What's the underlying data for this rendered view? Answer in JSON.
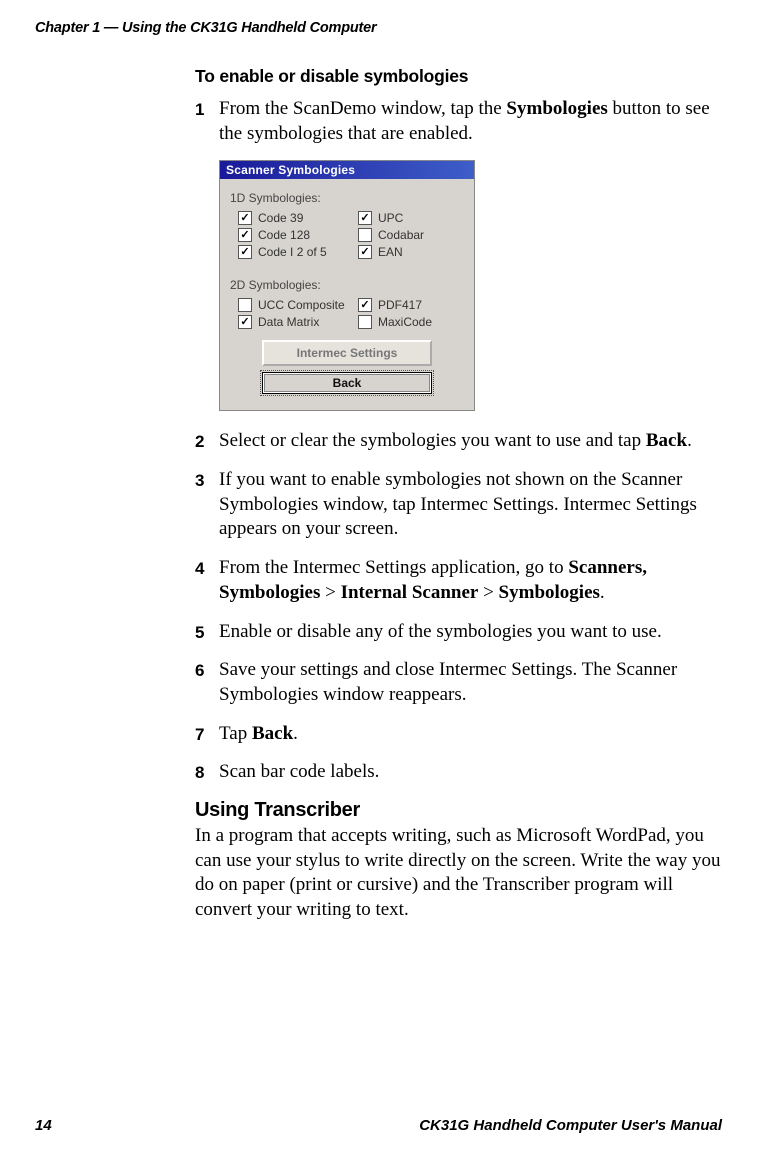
{
  "header": {
    "chapter_line": "Chapter 1 — Using the CK31G Handheld Computer"
  },
  "section_a": {
    "heading": "To enable or disable symbologies",
    "steps": {
      "s1": {
        "num": "1",
        "pre": "From the ScanDemo window, tap the ",
        "bold": "Symbologies",
        "post": " button to see the symbologies that are enabled."
      },
      "s2": {
        "num": "2",
        "pre": "Select or clear the symbologies you want to use and tap ",
        "bold": "Back",
        "post": "."
      },
      "s3": {
        "num": "3",
        "text": "If you want to enable symbologies not shown on the Scanner Symbologies window, tap Intermec Settings. Intermec Settings appears on your screen."
      },
      "s4": {
        "num": "4",
        "pre": "From the Intermec Settings application, go to ",
        "b1": "Scanners, Symbologies",
        "mid1": " > ",
        "b2": "Internal Scanner",
        "mid2": " > ",
        "b3": "Symbologies",
        "post": "."
      },
      "s5": {
        "num": "5",
        "text": "Enable or disable any of the symbologies you want to use."
      },
      "s6": {
        "num": "6",
        "text": "Save your settings and close Intermec Settings. The Scanner Symbologies window reappears."
      },
      "s7": {
        "num": "7",
        "pre": "Tap ",
        "bold": "Back",
        "post": "."
      },
      "s8": {
        "num": "8",
        "text": "Scan bar code labels."
      }
    }
  },
  "screenshot": {
    "title": "Scanner Symbologies",
    "group1_label": "1D Symbologies:",
    "group2_label": "2D Symbologies:",
    "cb": {
      "code39": "Code 39",
      "code128": "Code 128",
      "codei2of5": "Code I 2 of 5",
      "upc": "UPC",
      "codabar": "Codabar",
      "ean": "EAN",
      "ucc": "UCC Composite",
      "datamatrix": "Data Matrix",
      "pdf417": "PDF417",
      "maxicode": "MaxiCode"
    },
    "btn_intermec": "Intermec Settings",
    "btn_back": "Back"
  },
  "section_b": {
    "heading": "Using Transcriber",
    "para": "In a program that accepts writing, such as Microsoft WordPad, you can use your stylus to write directly on the screen. Write the way you do on paper (print or cursive) and the Transcriber program will convert your writing to text."
  },
  "footer": {
    "page_num": "14",
    "doc_title": "CK31G Handheld Computer User's Manual"
  }
}
